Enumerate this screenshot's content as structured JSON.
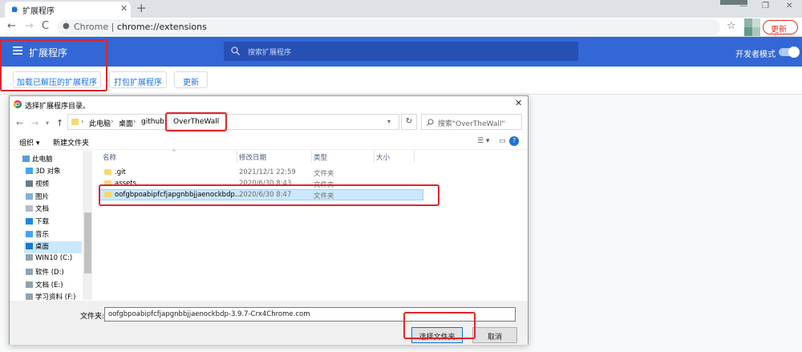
{
  "tab": {
    "title": "扩展程序",
    "close": "✕",
    "new": "+"
  },
  "window": {
    "min": "—",
    "max": "❐",
    "close": "✕"
  },
  "toolbar": {
    "back": "←",
    "forward": "→",
    "reload": "C",
    "omni_prefix": "Chrome | ",
    "url": "chrome://extensions",
    "star": "☆",
    "update_label": "更新 ⋮"
  },
  "ext": {
    "title": "扩展程序",
    "search_placeholder": "搜索扩展程序",
    "dev_mode": "开发者模式",
    "buttons": [
      "加载已解压的扩展程序",
      "打包扩展程序",
      "更新"
    ]
  },
  "dialog": {
    "title": "选择扩展程序目录。",
    "close": "✕",
    "crumbs": [
      "此电脑",
      "›",
      "桌面",
      "›",
      "github",
      "›",
      "OverTheWall",
      "›"
    ],
    "refresh": "↻",
    "search_placeholder": "搜索\"OverTheWall\"",
    "commands": {
      "organize": "组织 ▾",
      "new_folder": "新建文件夹",
      "help": "?"
    },
    "tree": [
      "此电脑",
      "3D 对象",
      "视频",
      "图片",
      "文档",
      "下载",
      "音乐",
      "桌面",
      "WIN10 (C:)",
      "软件 (D:)",
      "文档 (E:)",
      "学习资料 (F:)"
    ],
    "columns": [
      "名称",
      "修改日期",
      "类型",
      "大小"
    ],
    "files": [
      {
        "name": ".git",
        "date": "2021/12/1 22:59",
        "type": "文件夹"
      },
      {
        "name": "assets",
        "date": "2020/6/30 8:43",
        "type": "文件夹"
      },
      {
        "name": "oofgbpoabipfcfjapgnbbjjaenockbdp...",
        "date": "2020/6/30 8:47",
        "type": "文件夹"
      }
    ],
    "filename_label": "文件夹:",
    "filename_value": "oofgbpoabipfcfjapgnbbjjaenockbdp-3.9.7-Crx4Chrome.com",
    "select_button": "选择文件夹",
    "cancel_button": "取消"
  },
  "colors": {
    "accent": "#3367d6",
    "annotation": "#e0242b",
    "selection": "#cce8ff"
  }
}
